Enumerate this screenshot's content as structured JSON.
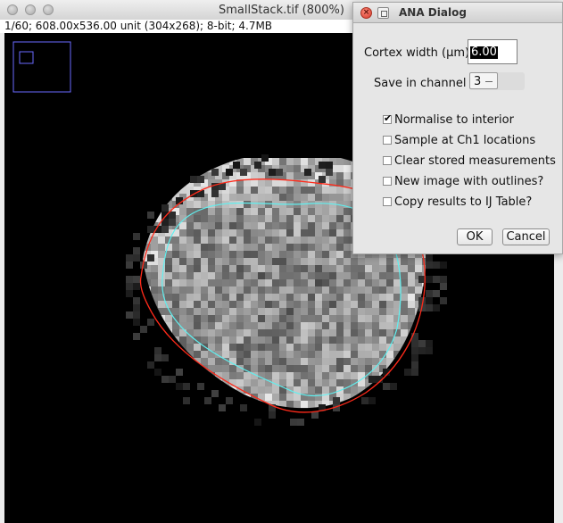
{
  "image_window": {
    "title": "SmallStack.tif (800%)",
    "info": "1/60; 608.00x536.00 unit (304x268); 8-bit; 4.7MB"
  },
  "dialog": {
    "title": "ANA Dialog",
    "cortex_width_label": "Cortex width (µm)",
    "cortex_width_value": "6.00",
    "save_channel_label": "Save in channel",
    "save_channel_value": "3",
    "checkboxes": [
      {
        "label": "Normalise to interior",
        "checked": true
      },
      {
        "label": "Sample at Ch1 locations",
        "checked": false
      },
      {
        "label": "Clear stored measurements",
        "checked": false
      },
      {
        "label": "New image with outlines?",
        "checked": false
      },
      {
        "label": "Copy results to IJ Table?",
        "checked": false
      }
    ],
    "ok_label": "OK",
    "cancel_label": "Cancel"
  },
  "colors": {
    "outer_outline": "#ff2a1a",
    "inner_outline": "#5ff0f0",
    "navigator": "#6a6aff"
  }
}
